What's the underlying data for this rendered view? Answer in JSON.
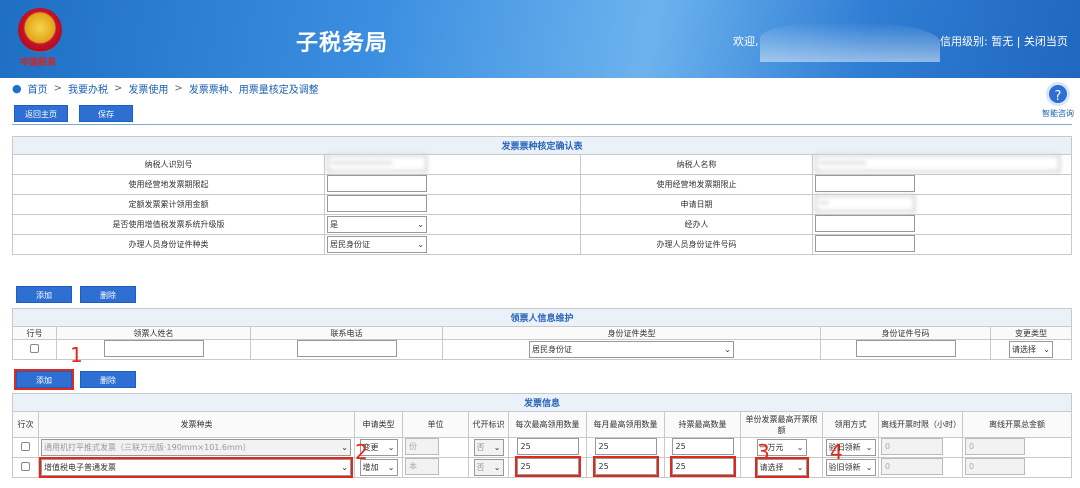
{
  "header": {
    "emblem_text": "中国税务",
    "title": "子税务局",
    "welcome": "欢迎,",
    "credit_label": "信用级别: 暂无",
    "close_label": "关闭当页",
    "separator": "|"
  },
  "breadcrumb": [
    "首页",
    "我要办税",
    "发票使用",
    "发票票种、用票量核定及调整"
  ],
  "breadcrumb_sep": ">",
  "help": {
    "label": "智能咨询"
  },
  "toolbar": {
    "back_label": "返回主页",
    "save_label": "保存"
  },
  "confirm_table": {
    "caption": "发票票种核定确认表",
    "rows": [
      {
        "l1": "纳税人识别号",
        "v1": "",
        "l2": "纳税人名称",
        "v2": ""
      },
      {
        "l1": "使用经营地发票期限起",
        "v1": "",
        "l2": "使用经营地发票期限止",
        "v2": ""
      },
      {
        "l1": "定额发票累计领用金额",
        "v1": "",
        "l2": "申请日期",
        "v2": ""
      },
      {
        "l1": "是否使用增值税发票系统升级版",
        "v1": "是",
        "l2": "经办人",
        "v2": ""
      },
      {
        "l1": "办理人员身份证件种类",
        "v1": "居民身份证",
        "l2": "办理人员身份证件号码",
        "v2": ""
      }
    ]
  },
  "collector": {
    "add_label": "添加",
    "delete_label": "删除",
    "caption": "领票人信息维护",
    "headers": [
      "行号",
      "领票人姓名",
      "联系电话",
      "身份证件类型",
      "身份证件号码",
      "变更类型"
    ],
    "row": {
      "id_type": "居民身份证",
      "change_type": "请选择"
    }
  },
  "invoice": {
    "add_label": "添加",
    "delete_label": "删除",
    "caption": "发票信息",
    "headers": [
      "行次",
      "发票种类",
      "申请类型",
      "单位",
      "代开标识",
      "每次最高领用数量",
      "每月最高领用数量",
      "持票最高数量",
      "单份发票最高开票限额",
      "领用方式",
      "离线开票时限（小时）",
      "离线开票总金额"
    ],
    "rows": [
      {
        "kind": "通用机打平推式发票（三联万元版·190mm×101.6mm）",
        "apply": "变更",
        "unit": "份",
        "agent": "否",
        "per_time": "25",
        "per_month": "25",
        "max_hold": "25",
        "limit": "一万元",
        "method": "验旧领新",
        "offline_hours": "0",
        "offline_amount": "0"
      },
      {
        "kind": "增值税电子普通发票",
        "apply": "增加",
        "unit": "本",
        "agent": "否",
        "per_time": "25",
        "per_month": "25",
        "max_hold": "25",
        "limit": "请选择",
        "method": "验旧领新",
        "offline_hours": "0",
        "offline_amount": "0"
      }
    ]
  },
  "annotations": [
    "1",
    "2",
    "3",
    "4"
  ],
  "colors": {
    "accent": "#2d6fd2",
    "highlight": "#e0281d",
    "caption_text": "#2a66b8"
  }
}
